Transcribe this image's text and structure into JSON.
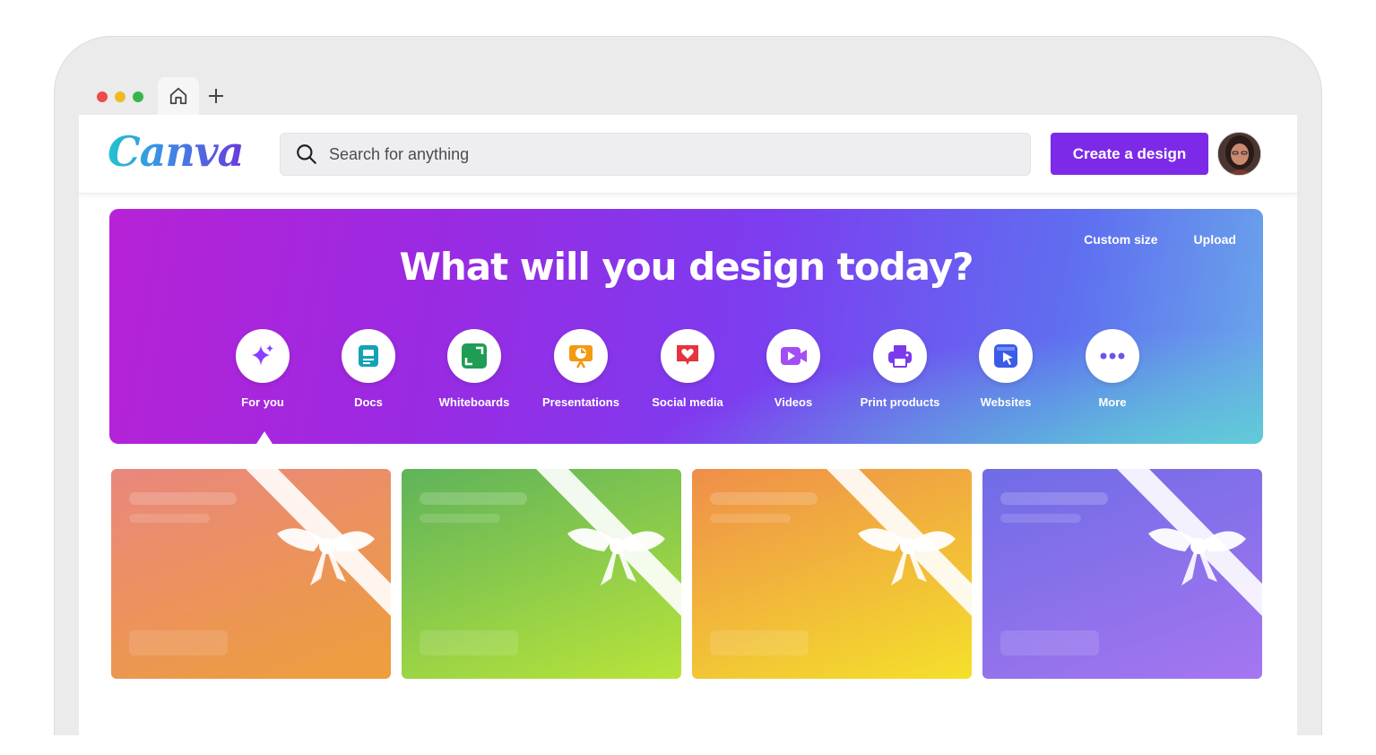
{
  "browser": {
    "window_dots": [
      "#ee4b4b",
      "#f2b824",
      "#38b54a"
    ],
    "home_icon": "home-icon",
    "new_tab_icon": "plus-icon"
  },
  "header": {
    "logo_text": "Canva",
    "search_placeholder": "Search for anything",
    "create_button": "Create a design"
  },
  "hero": {
    "title": "What will you design today?",
    "links": [
      "Custom size",
      "Upload"
    ],
    "categories": [
      {
        "label": "For you",
        "icon": "sparkle-icon",
        "color": "#8b3dff",
        "selected": true
      },
      {
        "label": "Docs",
        "icon": "doc-icon",
        "color": "#13a3b5"
      },
      {
        "label": "Whiteboards",
        "icon": "whiteboard-icon",
        "color": "#1f9d55"
      },
      {
        "label": "Presentations",
        "icon": "presentation-icon",
        "color": "#f29a11"
      },
      {
        "label": "Social media",
        "icon": "heart-icon",
        "color": "#e5343c"
      },
      {
        "label": "Videos",
        "icon": "video-icon",
        "color": "#a24ef2"
      },
      {
        "label": "Print products",
        "icon": "printer-icon",
        "color": "#7c3aed"
      },
      {
        "label": "Websites",
        "icon": "cursor-icon",
        "color": "#3b5ce8"
      },
      {
        "label": "More",
        "icon": "more-icon",
        "color": "#6b56e8"
      }
    ]
  },
  "gift_cards": [
    {
      "gradient": [
        "#e9877e",
        "#ee9f3a"
      ]
    },
    {
      "gradient": [
        "#5fb35b",
        "#b9e43a"
      ]
    },
    {
      "gradient": [
        "#ef8e4a",
        "#f4e02b"
      ]
    },
    {
      "gradient": [
        "#6f6ce6",
        "#a576f0"
      ]
    }
  ]
}
